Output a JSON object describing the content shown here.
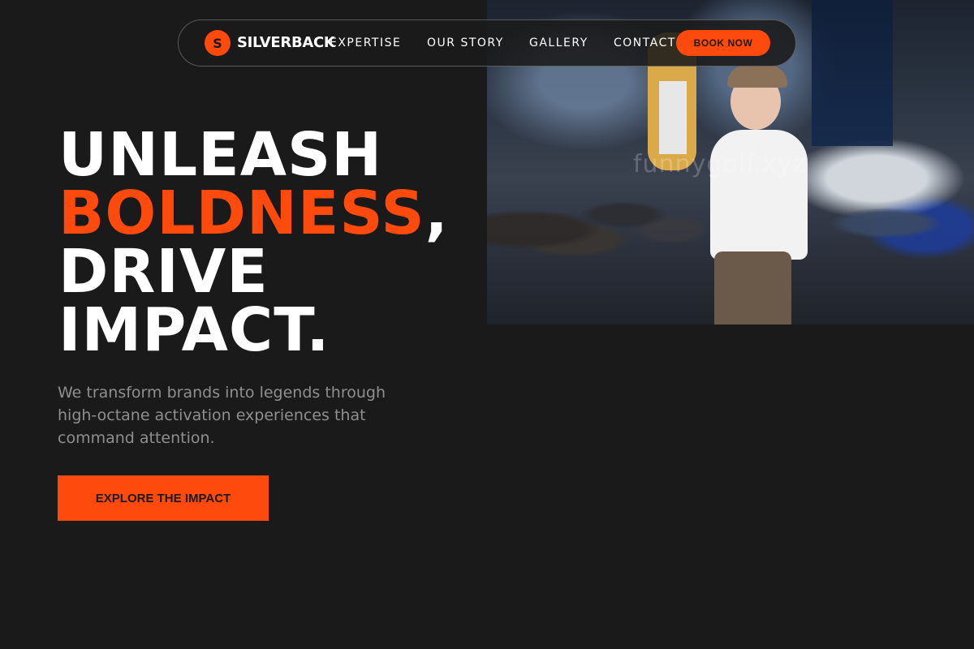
{
  "colors": {
    "background": "#1a1a1a",
    "accent": "#ff4a0d",
    "text": "#ffffff",
    "muted": "#8f8f8f"
  },
  "nav": {
    "logo_letter": "S",
    "brand": "SILVERBACK",
    "links": [
      "EXPERTISE",
      "OUR STORY",
      "GALLERY",
      "CONTACT"
    ],
    "cta": "BOOK NOW"
  },
  "hero": {
    "line1": "UNLEASH",
    "line2_accent": "BOLDNESS",
    "line2_rest": ",",
    "line3": "DRIVE",
    "line4": "IMPACT.",
    "subtext": "We transform brands into legends through high-octane activation experiences that command attention.",
    "cta": "EXPLORE THE IMPACT"
  },
  "photo": {
    "watermark": "funnygolf.xyz"
  }
}
